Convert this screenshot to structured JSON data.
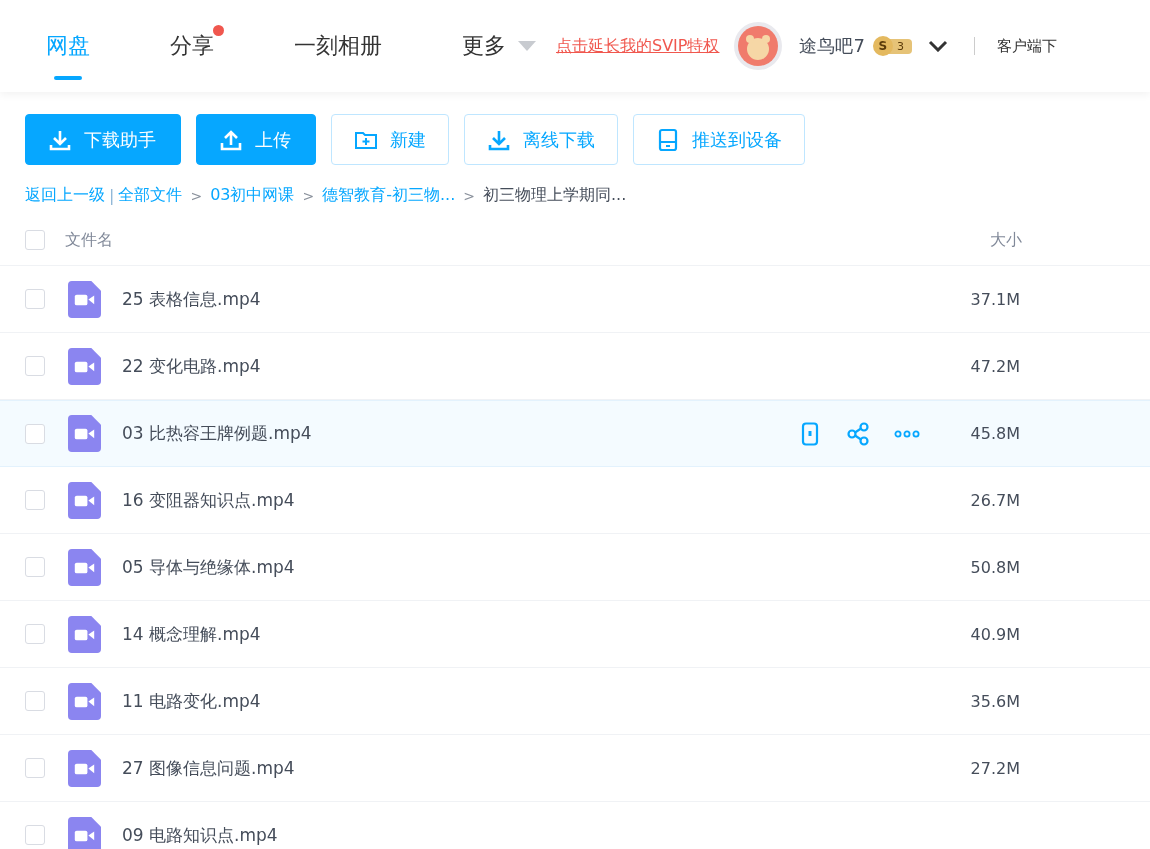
{
  "nav": {
    "tabs": [
      {
        "label": "网盘",
        "selected": true,
        "dot": false
      },
      {
        "label": "分享",
        "selected": false,
        "dot": true
      },
      {
        "label": "一刻相册",
        "selected": false,
        "dot": false
      },
      {
        "label": "更多",
        "selected": false,
        "dot": false,
        "caret": true
      }
    ],
    "promo_link": "点击延长我的SVIP特权",
    "username": "途鸟吧7",
    "badge": {
      "letter": "S",
      "level": "3"
    },
    "client_link": "客户端下"
  },
  "toolbar": [
    {
      "label": "下载助手",
      "kind": "primary"
    },
    {
      "label": "上传",
      "kind": "primary"
    },
    {
      "label": "新建",
      "kind": "outline"
    },
    {
      "label": "离线下载",
      "kind": "outline"
    },
    {
      "label": "推送到设备",
      "kind": "outline"
    }
  ],
  "breadcrumb": {
    "back": "返回上一级",
    "divider": "|",
    "items": [
      {
        "label": "全部文件",
        "current": false
      },
      {
        "separator": ">",
        "label": "03初中网课",
        "current": false
      },
      {
        "separator": ">",
        "label": "德智教育-初三物...",
        "current": false
      },
      {
        "separator": ">",
        "label": "初三物理上学期同...",
        "current": true
      }
    ]
  },
  "table": {
    "columns": [
      "文件名",
      "大小"
    ],
    "all_checked": false,
    "rows": [
      {
        "name": "25 表格信息.mp4",
        "size": "37.1M",
        "checked": false,
        "hovered": false
      },
      {
        "name": "22 变化电路.mp4",
        "size": "47.2M",
        "checked": false,
        "hovered": false
      },
      {
        "name": "03 比热容王牌例题.mp4",
        "size": "45.8M",
        "checked": false,
        "hovered": true
      },
      {
        "name": "16 变阻器知识点.mp4",
        "size": "26.7M",
        "checked": false,
        "hovered": false
      },
      {
        "name": "05 导体与绝缘体.mp4",
        "size": "50.8M",
        "checked": false,
        "hovered": false
      },
      {
        "name": "14 概念理解.mp4",
        "size": "40.9M",
        "checked": false,
        "hovered": false
      },
      {
        "name": "11 电路变化.mp4",
        "size": "35.6M",
        "checked": false,
        "hovered": false
      },
      {
        "name": "27 图像信息问题.mp4",
        "size": "27.2M",
        "checked": false,
        "hovered": false
      },
      {
        "name": "09 电路知识点.mp4",
        "checked": false,
        "hovered": false
      }
    ]
  }
}
